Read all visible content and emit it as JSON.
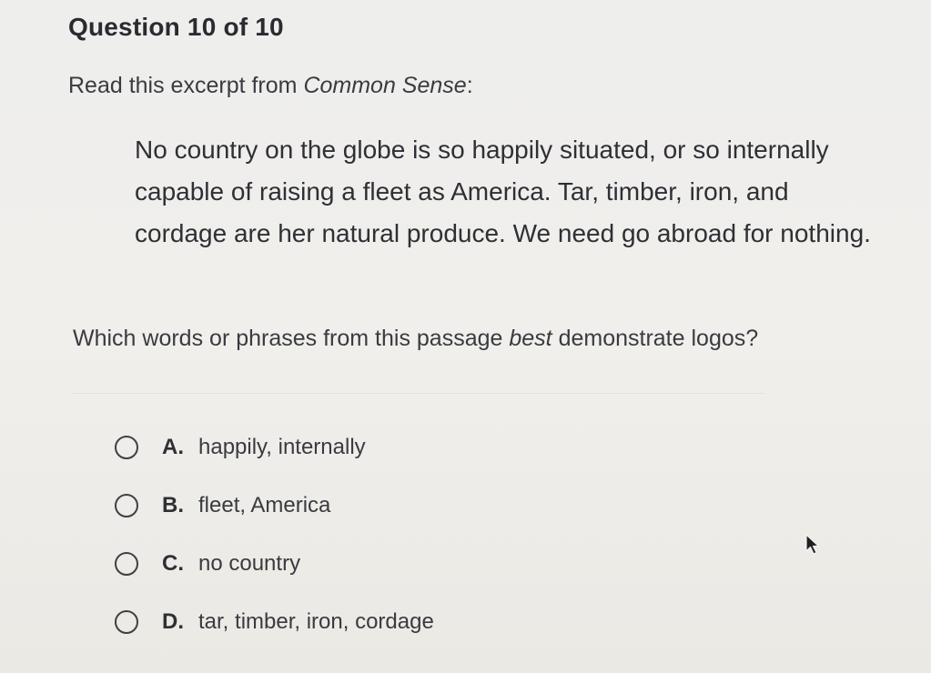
{
  "header": {
    "title": "Question 10 of 10"
  },
  "prompt": {
    "lead": "Read this excerpt from ",
    "work_title": "Common Sense",
    "trail": ":"
  },
  "passage": {
    "text": "No country on the globe is so happily situated, or so internally capable of raising a fleet as America. Tar, timber, iron, and cordage are her natural produce. We need go abroad for nothing."
  },
  "question": {
    "pre": "Which words or phrases from this passage ",
    "emphasis": "best",
    "post": " demonstrate logos?"
  },
  "choices": [
    {
      "letter": "A.",
      "text": "happily, internally"
    },
    {
      "letter": "B.",
      "text": "fleet, America"
    },
    {
      "letter": "C.",
      "text": "no country"
    },
    {
      "letter": "D.",
      "text": "tar, timber, iron, cordage"
    }
  ],
  "cursor": {
    "icon": "mouse-pointer-icon"
  }
}
